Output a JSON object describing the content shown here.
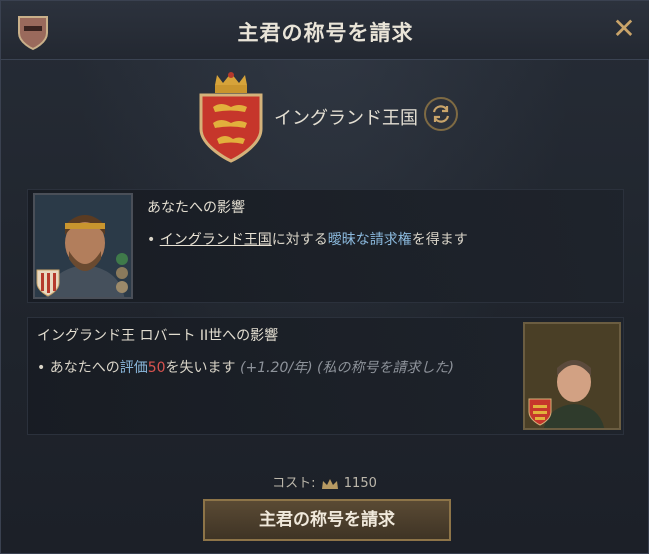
{
  "window": {
    "title": "主君の称号を請求",
    "close_icon": "close-icon"
  },
  "title_target": {
    "name": "イングランド王国",
    "swap_icon": "swap-icon"
  },
  "impact_you": {
    "heading": "あなたへの影響",
    "bullet": "•",
    "line_link": "イングランド王国",
    "line_middle": "に対する",
    "line_blue1": "曖昧な請求権",
    "line_end": "を得ます"
  },
  "impact_liege": {
    "heading": "イングランド王 ロバート II世への影響",
    "bullet": "•",
    "line_prefix": "あなたへの",
    "line_blue": "評価",
    "line_value": "50",
    "line_suffix": "を失います",
    "line_note": "(+1.20/年) (私の称号を請求した)"
  },
  "cost": {
    "label": "コスト:",
    "value": "1150",
    "icon": "prestige-crown-icon"
  },
  "confirm_button": {
    "label": "主君の称号を請求"
  },
  "colors": {
    "accent_gold": "#c9a46a",
    "link_blue": "#8ab8dc",
    "negative_red": "#d9534f"
  }
}
